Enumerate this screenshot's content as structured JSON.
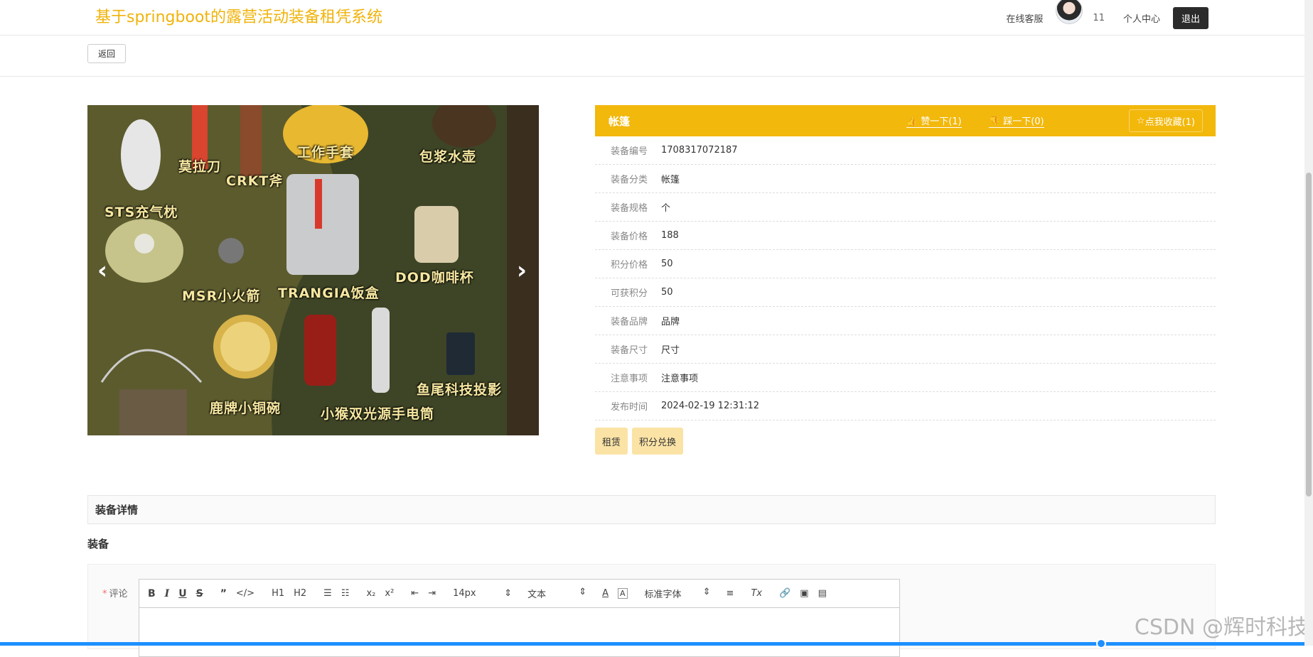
{
  "header": {
    "site_title": "基于springboot的露营活动装备租凭系统",
    "online_service": "在线客服",
    "username": "11",
    "personal_center": "个人中心",
    "logout": "退出"
  },
  "back_label": "返回",
  "carousel": {
    "prev_arrow": "‹",
    "next_arrow": "›",
    "image_labels": [
      "莫拉刀",
      "CRKT斧",
      "工作手套",
      "包浆水壶",
      "STS充气枕",
      "MSR小火箭",
      "TRANGIA饭盒",
      "DOD咖啡杯",
      "鹿牌小铜碗",
      "小猴双光源手电筒",
      "鱼尾科技投影"
    ]
  },
  "product": {
    "name": "帐篷",
    "like_label": "赞一下(1)",
    "dislike_label": "踩一下(0)",
    "favorite_label": "点我收藏(1)",
    "fields": [
      {
        "label": "装备编号",
        "value": "1708317072187"
      },
      {
        "label": "装备分类",
        "value": "帐篷"
      },
      {
        "label": "装备规格",
        "value": "个"
      },
      {
        "label": "装备价格",
        "value": "188"
      },
      {
        "label": "积分价格",
        "value": "50"
      },
      {
        "label": "可获积分",
        "value": "50"
      },
      {
        "label": "装备品牌",
        "value": "品牌"
      },
      {
        "label": "装备尺寸",
        "value": "尺寸"
      },
      {
        "label": "注意事项",
        "value": "注意事项"
      },
      {
        "label": "发布时间",
        "value": "2024-02-19 12:31:12"
      }
    ],
    "actions": {
      "rent": "租赁",
      "points_exchange": "积分兑换"
    }
  },
  "detail": {
    "section_title": "装备详情",
    "content": "装备"
  },
  "comment": {
    "required_mark": "*",
    "label": "评论",
    "toolbar": {
      "bold": "B",
      "italic": "I",
      "underline": "U",
      "strike": "S",
      "quote": "”",
      "code": "</>",
      "h1": "H1",
      "h2": "H2",
      "ordered_list": "☰",
      "bullet_list": "☷",
      "subscript": "x₂",
      "superscript": "x²",
      "outdent": "⇤",
      "indent": "⇥",
      "size": "14px",
      "header_select": "文本",
      "font_color": "A",
      "bg_color": "A",
      "font_select": "标准字体",
      "align": "≡",
      "clean": "Tx",
      "link": "🔗",
      "image": "▣",
      "video": "▤",
      "select_caret": "⇕"
    }
  },
  "watermark": "CSDN @辉时科技",
  "colors": {
    "brand": "#f2b80c",
    "title": "#f0b30a",
    "action_bg": "#fbe3a6",
    "dark_button": "#2b2b2b"
  }
}
